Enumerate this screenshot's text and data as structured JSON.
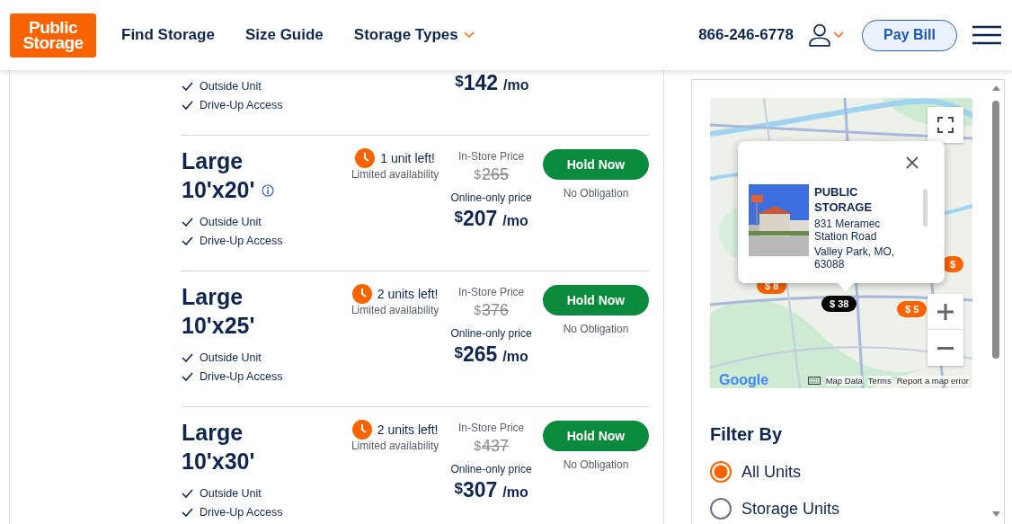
{
  "header": {
    "logo": [
      "Public",
      "Storage"
    ],
    "nav": [
      {
        "label": "Find Storage",
        "dropdown": false
      },
      {
        "label": "Size Guide",
        "dropdown": false
      },
      {
        "label": "Storage Types",
        "dropdown": true
      }
    ],
    "phone": "866-246-6778",
    "account_dropdown": true,
    "pay_bill": "Pay Bill"
  },
  "units": [
    {
      "features": [
        "Outside Unit",
        "Drive-Up Access"
      ],
      "online_price": {
        "currency": "$",
        "amount": "142",
        "per": "/mo"
      }
    },
    {
      "title": "Large",
      "size": "10'x20'",
      "info": true,
      "availability": "1 unit left!",
      "availability_note": "Limited availability",
      "in_store_label": "In-Store Price",
      "in_store_price": {
        "currency": "$",
        "amount": "265"
      },
      "online_label": "Online-only price",
      "online_price": {
        "currency": "$",
        "amount": "207",
        "per": "/mo"
      },
      "button": "Hold Now",
      "button_note": "No Obligation",
      "features": [
        "Outside Unit",
        "Drive-Up Access"
      ]
    },
    {
      "title": "Large",
      "size": "10'x25'",
      "info": false,
      "availability": "2 units left!",
      "availability_note": "Limited availability",
      "in_store_label": "In-Store Price",
      "in_store_price": {
        "currency": "$",
        "amount": "376"
      },
      "online_label": "Online-only price",
      "online_price": {
        "currency": "$",
        "amount": "265",
        "per": "/mo"
      },
      "button": "Hold Now",
      "button_note": "No Obligation",
      "features": [
        "Outside Unit",
        "Drive-Up Access"
      ]
    },
    {
      "title": "Large",
      "size": "10'x30'",
      "info": false,
      "availability": "2 units left!",
      "availability_note": "Limited availability",
      "in_store_label": "In-Store Price",
      "in_store_price": {
        "currency": "$",
        "amount": "437"
      },
      "online_label": "Online-only price",
      "online_price": {
        "currency": "$",
        "amount": "307",
        "per": "/mo"
      },
      "button": "Hold Now",
      "button_note": "No Obligation",
      "features": [
        "Outside Unit",
        "Drive-Up Access"
      ]
    }
  ],
  "map": {
    "markers": [
      {
        "label": "$ 8",
        "selected": false
      },
      {
        "label": "$",
        "selected": false
      },
      {
        "label": "$ 5",
        "selected": false
      },
      {
        "label": "$ 38",
        "selected": true
      }
    ],
    "popup": {
      "title": "PUBLIC STORAGE",
      "address": [
        "831 Meramec Station Road",
        "Valley Park, MO, 63088"
      ]
    },
    "logo": "Google",
    "footer_links": [
      "Map Data",
      "Terms",
      "Report a map error"
    ]
  },
  "filter": {
    "title": "Filter By",
    "options": [
      {
        "label": "All Units",
        "selected": true
      },
      {
        "label": "Storage Units",
        "selected": false
      }
    ]
  }
}
